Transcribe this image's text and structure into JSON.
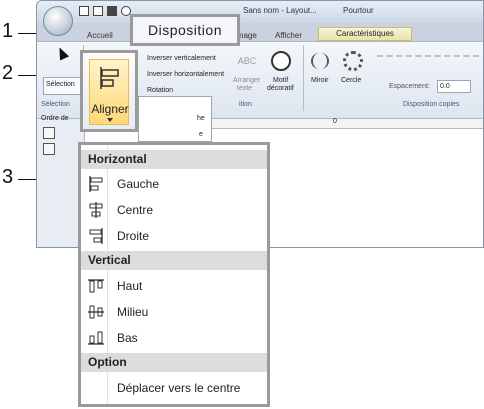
{
  "callouts": [
    "1",
    "2",
    "3"
  ],
  "titlebar": {
    "document_title": "Sans nom - Layout...",
    "context_title": "Pourtour"
  },
  "tabs": {
    "accueil": "Accueil",
    "disposition": "Disposition",
    "image": "image",
    "afficher": "Afficher",
    "caracteristiques": "Caractéristiques"
  },
  "ribbon": {
    "select_label": "Sélection",
    "select_group": "Sélection",
    "flip_v": "Inverser verticalement",
    "flip_h": "Inverser horizontalement",
    "rotation": "Rotation",
    "arranger": "Arranger",
    "arranger_sub": "texte",
    "motif": "Motif",
    "motif_sub": "décoratif",
    "miroir": "Miroir",
    "cercle": "Cercle",
    "espacement_label": "Espacement:",
    "espacement_value": "0.0",
    "group_position": "ition",
    "group_copies": "Disposition copies",
    "order_label": "Ordre de",
    "aligner": "Aligner"
  },
  "small_menu": {
    "items": [
      "he",
      "e"
    ]
  },
  "ruler": {
    "zero": "0"
  },
  "menu": {
    "horizontal": "Horizontal",
    "gauche": "Gauche",
    "centre": "Centre",
    "droite": "Droite",
    "vertical": "Vertical",
    "haut": "Haut",
    "milieu": "Milieu",
    "bas": "Bas",
    "option": "Option",
    "deplacer": "Déplacer vers le centre"
  }
}
